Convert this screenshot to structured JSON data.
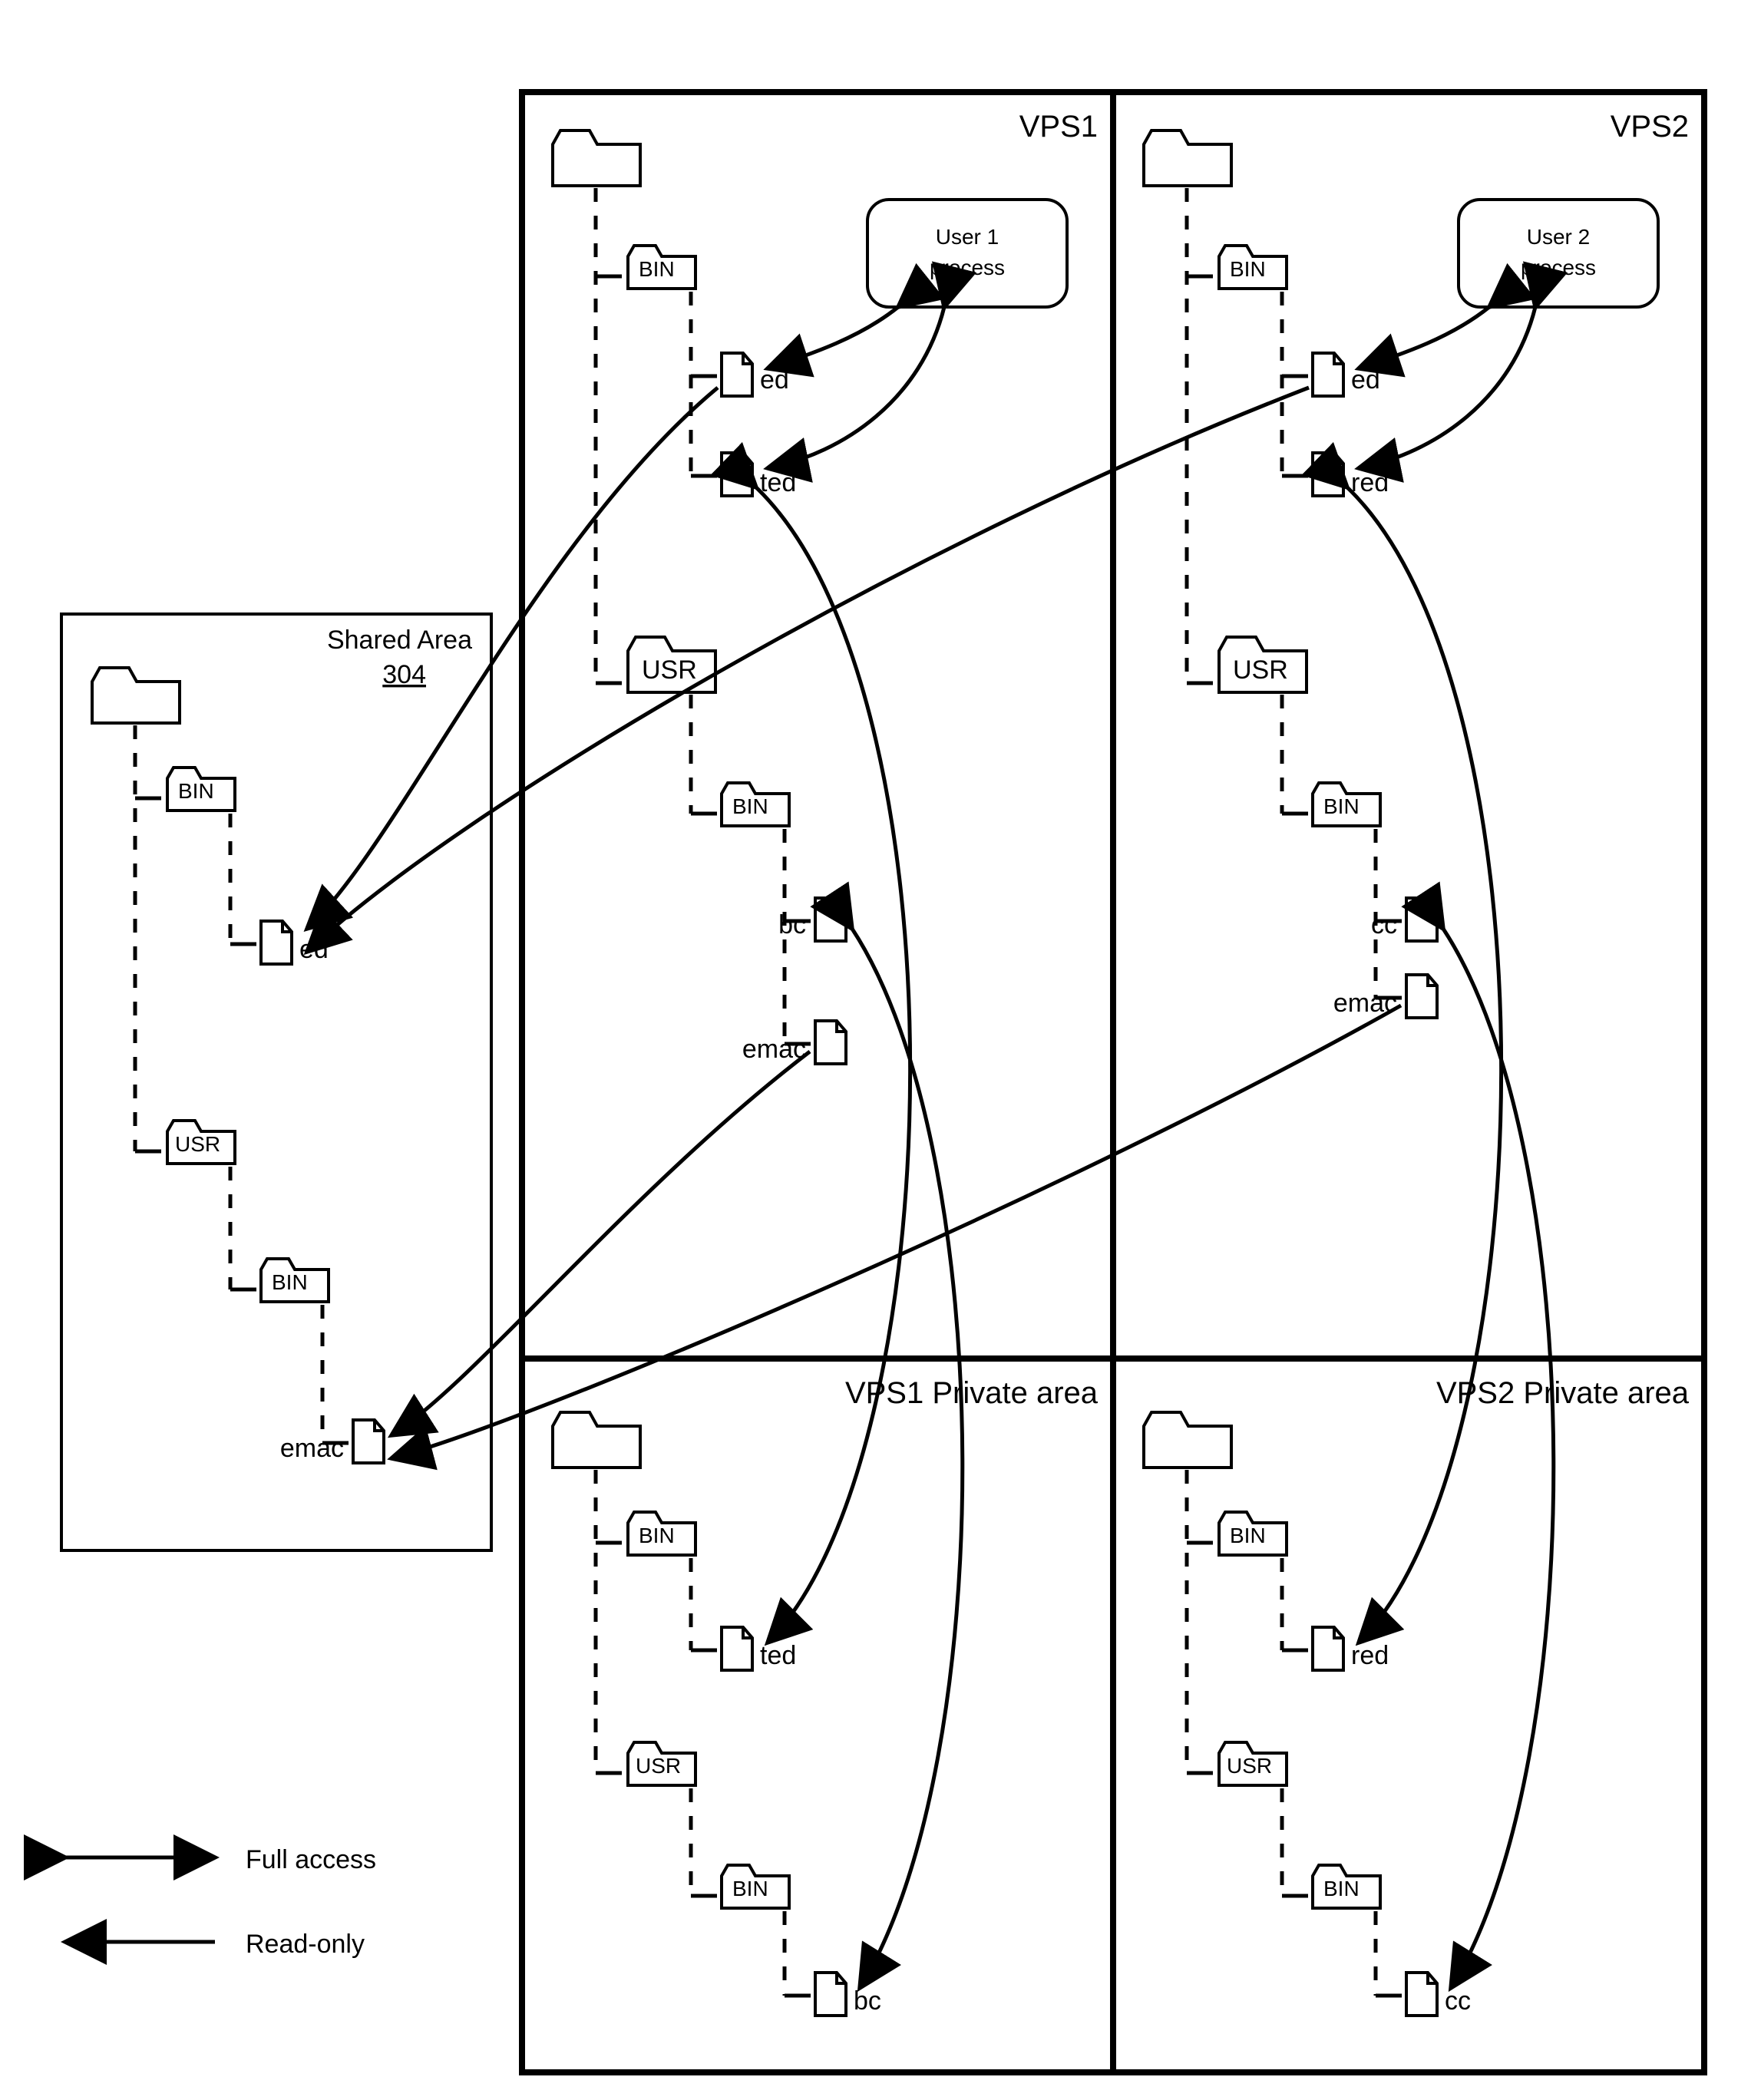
{
  "legend": {
    "full": "Full access",
    "read": "Read-only"
  },
  "shared": {
    "title": "Shared Area",
    "ref": "304",
    "bin": "BIN",
    "usr": "USR",
    "bin2": "BIN",
    "ed": "ed",
    "emac": "emac"
  },
  "vps1": {
    "title": "VPS1",
    "user": "User 1 process",
    "bin": "BIN",
    "ed": "ed",
    "ted": "ted",
    "usr": "USR",
    "bin2": "BIN",
    "bc": "bc",
    "emac": "emac"
  },
  "vps2": {
    "title": "VPS2",
    "user": "User 2 process",
    "bin": "BIN",
    "ed": "ed",
    "red": "red",
    "usr": "USR",
    "bin2": "BIN",
    "cc": "cc",
    "emac": "emac"
  },
  "vps1p": {
    "title": "VPS1 Private area",
    "bin": "BIN",
    "ted": "ted",
    "usr": "USR",
    "bin2": "BIN",
    "bc": "bc"
  },
  "vps2p": {
    "title": "VPS2 Private area",
    "bin": "BIN",
    "red": "red",
    "usr": "USR",
    "bin2": "BIN",
    "cc": "cc"
  }
}
